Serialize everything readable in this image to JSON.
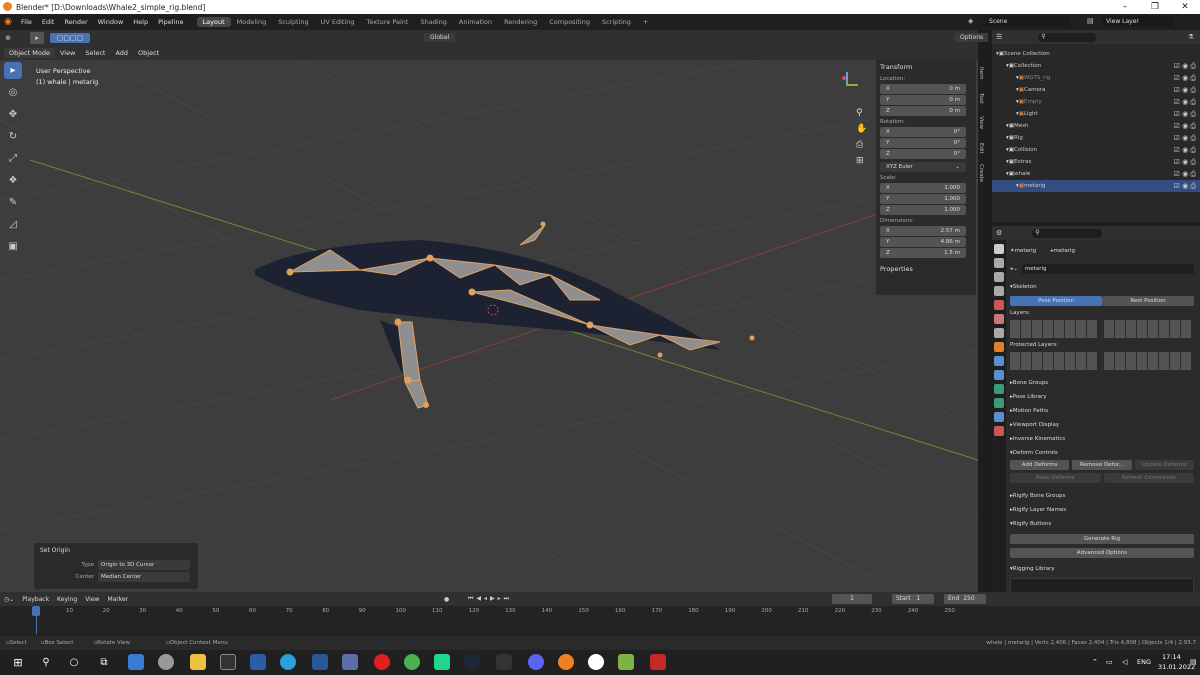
{
  "window": {
    "title": "Blender* [D:\\Downloads\\Whale2_simple_rig.blend]",
    "minimize": "–",
    "maximize": "❐",
    "close": "✕"
  },
  "menu": [
    "File",
    "Edit",
    "Render",
    "Window",
    "Help",
    "Pipeline"
  ],
  "workspaces": [
    "Layout",
    "Modeling",
    "Sculpting",
    "UV Editing",
    "Texture Paint",
    "Shading",
    "Animation",
    "Rendering",
    "Compositing",
    "Scripting"
  ],
  "active_workspace": "Layout",
  "scene": "Scene",
  "view_layer": "View Layer",
  "viewport_header": {
    "mode": "Object Mode",
    "view": "View",
    "select": "Select",
    "add": "Add",
    "object": "Object",
    "transform": "Global",
    "options": "Options"
  },
  "viewport": {
    "perspective": "User Perspective",
    "object": "(1) whale | metarig"
  },
  "npanel": {
    "title": "Transform",
    "location_label": "Location:",
    "location": [
      {
        "a": "X",
        "v": "0 m"
      },
      {
        "a": "Y",
        "v": "0 m"
      },
      {
        "a": "Z",
        "v": "0 m"
      }
    ],
    "rotation_label": "Rotation:",
    "rotation": [
      {
        "a": "X",
        "v": "0°"
      },
      {
        "a": "Y",
        "v": "0°"
      },
      {
        "a": "Z",
        "v": "0°"
      }
    ],
    "rotation_mode": "XYZ Euler",
    "scale_label": "Scale:",
    "scale": [
      {
        "a": "X",
        "v": "1.000"
      },
      {
        "a": "Y",
        "v": "1.000"
      },
      {
        "a": "Z",
        "v": "1.000"
      }
    ],
    "dimensions_label": "Dimensions:",
    "dimensions": [
      {
        "a": "X",
        "v": "2.57 m"
      },
      {
        "a": "Y",
        "v": "4.86 m"
      },
      {
        "a": "Z",
        "v": "1.5 m"
      }
    ],
    "properties": "Properties"
  },
  "ntabs": [
    "Item",
    "Tool",
    "View",
    "Edit",
    "Create"
  ],
  "outliner": [
    {
      "name": "Scene Collection",
      "indent": 0,
      "color": "#ccc",
      "vis": false
    },
    {
      "name": "Collection",
      "indent": 1,
      "color": "#ccc",
      "vis": true
    },
    {
      "name": "WGTS_rig",
      "indent": 2,
      "color": "#888",
      "vis": true
    },
    {
      "name": "Camera",
      "indent": 2,
      "color": "#ccc",
      "vis": true
    },
    {
      "name": "Empty",
      "indent": 2,
      "color": "#888",
      "vis": true
    },
    {
      "name": "Light",
      "indent": 2,
      "color": "#ccc",
      "vis": true
    },
    {
      "name": "Mesh",
      "indent": 1,
      "color": "#ccc",
      "vis": true
    },
    {
      "name": "Rig",
      "indent": 1,
      "color": "#ccc",
      "vis": true
    },
    {
      "name": "Collision",
      "indent": 1,
      "color": "#ccc",
      "vis": true
    },
    {
      "name": "Extras",
      "indent": 1,
      "color": "#ccc",
      "vis": true
    },
    {
      "name": "whale",
      "indent": 1,
      "color": "#ccc",
      "vis": true
    },
    {
      "name": "metarig",
      "indent": 2,
      "color": "#ccc",
      "vis": true,
      "selected": true
    }
  ],
  "props": {
    "object": "metarig",
    "data": "metarig",
    "data_name": "metarig",
    "skeleton": "Skeleton",
    "pose_position": "Pose Position",
    "rest_position": "Rest Position",
    "layers": "Layers:",
    "protected_layers": "Protected Layers:",
    "panels": [
      "Bone Groups",
      "Pose Library",
      "Motion Paths",
      "Viewport Display",
      "Inverse Kinematics"
    ],
    "deform": "Deform Controls",
    "add_deform": "Add Deforms",
    "remove_deform": "Remove Defor...",
    "update_deform": "Update Deforms",
    "bake_deform": "Bake Deforms",
    "refresh_constraints": "Refresh Constraints",
    "rigify": [
      "Rigify Bone Groups",
      "Rigify Layer Names",
      "Rigify Buttons"
    ],
    "generate_rig": "Generate Rig",
    "advanced_options": "Advanced Options",
    "rigging_library": "Rigging Library"
  },
  "set_origin": {
    "title": "Set Origin",
    "type_label": "Type",
    "type": "Origin to 3D Cursor",
    "center_label": "Center",
    "center": "Median Center"
  },
  "timeline": {
    "playback": "Playback",
    "keying": "Keying",
    "view": "View",
    "marker": "Marker",
    "current": "1",
    "start_label": "Start",
    "start": "1",
    "end_label": "End",
    "end": "250",
    "ticks": [
      "10",
      "20",
      "30",
      "40",
      "50",
      "60",
      "70",
      "80",
      "90",
      "100",
      "110",
      "120",
      "130",
      "140",
      "150",
      "160",
      "170",
      "180",
      "190",
      "200",
      "210",
      "220",
      "230",
      "240",
      "250"
    ]
  },
  "status": {
    "select": "Select",
    "box": "Box Select",
    "rotate": "Rotate View",
    "context": "Object Context Menu",
    "stats": "whale | metarig | Verts 2,406 | Faces 2,404 | Tris 4,808 | Objects 1/4 | 2.93.7"
  },
  "taskbar": {
    "lang": "ENG",
    "time": "17:14",
    "date": "31.01.2022"
  }
}
